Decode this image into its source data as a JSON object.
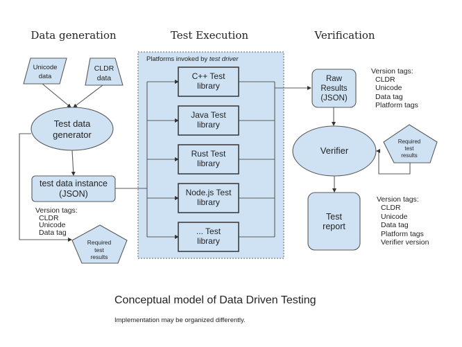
{
  "headings": {
    "data_generation": "Data generation",
    "test_execution": "Test Execution",
    "verification": "Verification"
  },
  "data_generation": {
    "unicode_data": [
      "Unicode",
      "data"
    ],
    "cldr_data": [
      "CLDR",
      "data"
    ],
    "generator": [
      "Test data",
      "generator"
    ],
    "instance": [
      "test data instance",
      "(JSON)"
    ],
    "version_tags": [
      "Version tags:",
      "CLDR",
      "Unicode",
      "Data tag"
    ],
    "required_results": [
      "Required",
      "test",
      "results"
    ]
  },
  "test_execution": {
    "container_label_prefix": "Platforms invoked by ",
    "container_label_italic": "test driver",
    "libraries": [
      [
        "C++ Test",
        "library"
      ],
      [
        "Java Test",
        "library"
      ],
      [
        "Rust Test",
        "library"
      ],
      [
        "Node.js Test",
        "library"
      ],
      [
        "... Test",
        "library"
      ]
    ]
  },
  "verification": {
    "raw_results": [
      "Raw",
      "Results",
      "(JSON)"
    ],
    "raw_version_tags": [
      "Version tags:",
      "CLDR",
      "Unicode",
      "Data tag",
      "Platform tags"
    ],
    "verifier": "Verifier",
    "required_results": [
      "Required",
      "test",
      "results"
    ],
    "test_report": [
      "Test",
      "report"
    ],
    "report_version_tags": [
      "Version tags:",
      "CLDR",
      "Unicode",
      "Data tag",
      "Platform tags",
      "Verifier version"
    ]
  },
  "caption": {
    "title": "Conceptual model of Data Driven Testing",
    "note": "Implementation may be organized differently."
  },
  "colors": {
    "node_fill": "#cfe2f3",
    "stroke": "#595959"
  }
}
